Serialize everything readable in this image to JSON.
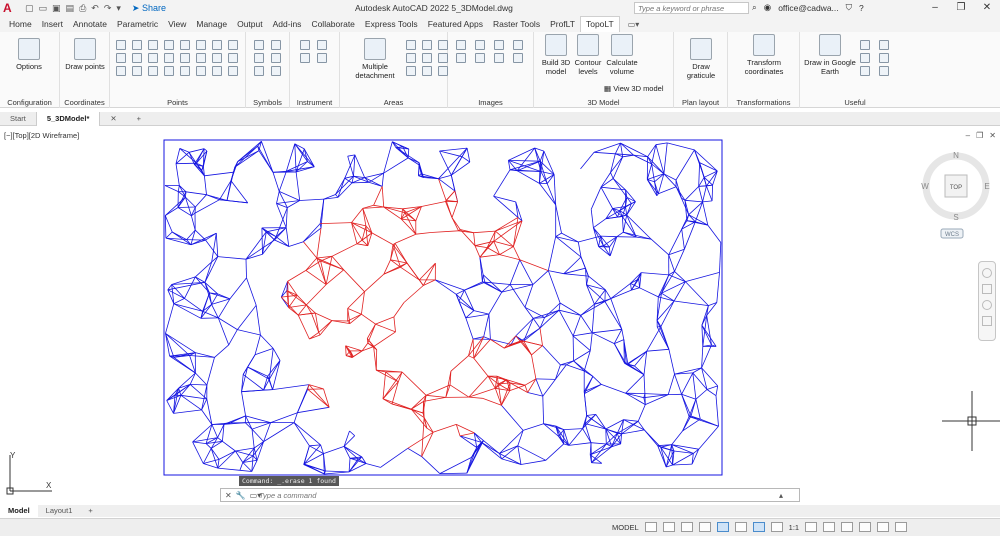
{
  "title_bar": {
    "app_logo": "A",
    "share_label": "Share",
    "title": "Autodesk AutoCAD 2022    5_3DModel.dwg",
    "search_placeholder": "Type a keyword or phrase",
    "user": "office@cadwa...",
    "cart_icon": "cart-icon",
    "help_icon": "help-icon"
  },
  "ribbon_tabs": [
    "Home",
    "Insert",
    "Annotate",
    "Parametric",
    "View",
    "Manage",
    "Output",
    "Add-ins",
    "Collaborate",
    "Express Tools",
    "Featured Apps",
    "Raster Tools",
    "ProfLT",
    "TopoLT"
  ],
  "active_tab": "TopoLT",
  "ribbon_panels": {
    "configuration": {
      "title": "Configuration",
      "options_label": "Options"
    },
    "coordinates": {
      "title": "Coordinates",
      "draw_points_label": "Draw points"
    },
    "points": {
      "title": "Points"
    },
    "symbols": {
      "title": "Symbols"
    },
    "instrument": {
      "title": "Instrument"
    },
    "areas": {
      "title": "Areas",
      "multiple_detachment_label": "Multiple detachment"
    },
    "images": {
      "title": "Images"
    },
    "model3d": {
      "title": "3D Model",
      "build_label": "Build 3D model",
      "contour_label": "Contour levels",
      "calculate_label": "Calculate volume",
      "view_label": "View 3D model"
    },
    "plan_layout": {
      "title": "Plan layout",
      "draw_graticule_label": "Draw graticule"
    },
    "transformations": {
      "title": "Transformations",
      "transform_label": "Transform coordinates"
    },
    "useful": {
      "title": "Useful",
      "google_earth_label": "Draw in Google Earth"
    }
  },
  "doc_tabs": [
    "Start",
    "5_3DModel*"
  ],
  "active_doc_tab": "5_3DModel*",
  "viewport_label": "[−][Top][2D Wireframe]",
  "viewcube": {
    "top": "TOP",
    "north": "N",
    "south": "S",
    "east": "E",
    "west": "W",
    "wcs": "WCS"
  },
  "ucs": {
    "x": "X",
    "y": "Y"
  },
  "command": {
    "history": "Command: _.erase 1 found",
    "placeholder": "Type a command"
  },
  "layout_tabs": [
    "Model",
    "Layout1"
  ],
  "active_layout_tab": "Model",
  "status_bar": {
    "model_label": "MODEL",
    "scale_label": "1:1"
  },
  "colors": {
    "mesh_blue": "#1414e0",
    "mesh_red": "#e02020",
    "accent_blue": "#0067c0",
    "background": "#ffffff"
  }
}
